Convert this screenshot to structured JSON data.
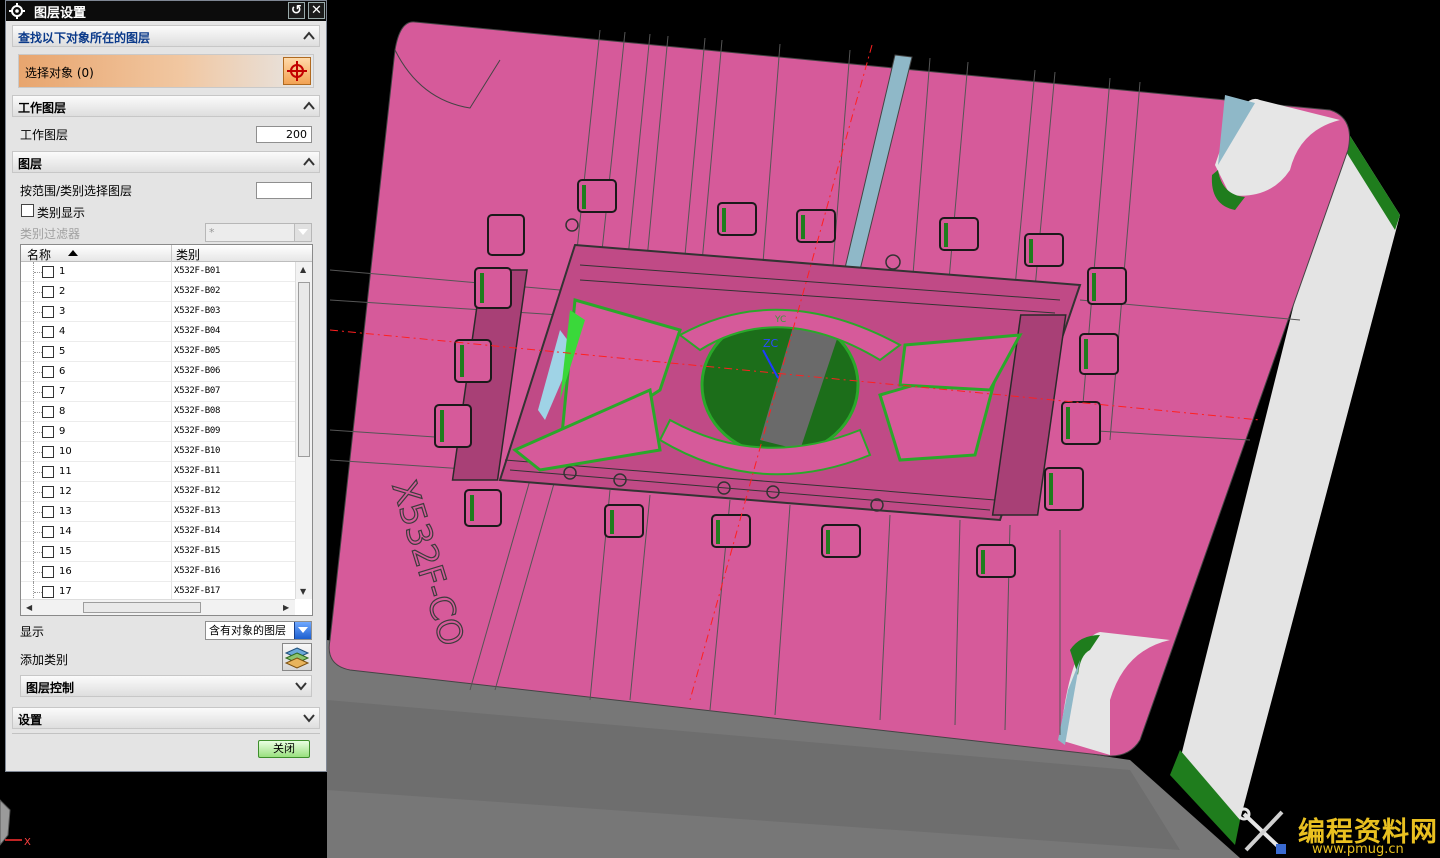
{
  "dialog": {
    "title": "图层设置",
    "find_section": {
      "label": "查找以下对象所在的图层",
      "select_object": "选择对象 (0)"
    },
    "work_layer_section": {
      "label": "工作图层",
      "work_layer_label": "工作图层",
      "work_layer_value": "200"
    },
    "layers_section": {
      "label": "图层",
      "range_select_label": "按范围/类别选择图层",
      "range_select_value": "",
      "category_display_label": "类别显示",
      "category_filter_label": "类别过滤器",
      "category_filter_value": "*",
      "columns": [
        "名称",
        "类别"
      ],
      "rows": [
        {
          "name": "1",
          "category": "X532F-B01"
        },
        {
          "name": "2",
          "category": "X532F-B02"
        },
        {
          "name": "3",
          "category": "X532F-B03"
        },
        {
          "name": "4",
          "category": "X532F-B04"
        },
        {
          "name": "5",
          "category": "X532F-B05"
        },
        {
          "name": "6",
          "category": "X532F-B06"
        },
        {
          "name": "7",
          "category": "X532F-B07"
        },
        {
          "name": "8",
          "category": "X532F-B08"
        },
        {
          "name": "9",
          "category": "X532F-B09"
        },
        {
          "name": "10",
          "category": "X532F-B10"
        },
        {
          "name": "11",
          "category": "X532F-B11"
        },
        {
          "name": "12",
          "category": "X532F-B12"
        },
        {
          "name": "13",
          "category": "X532F-B13"
        },
        {
          "name": "14",
          "category": "X532F-B14"
        },
        {
          "name": "15",
          "category": "X532F-B15"
        },
        {
          "name": "16",
          "category": "X532F-B16"
        },
        {
          "name": "17",
          "category": "X532F-B17"
        }
      ],
      "display_label": "显示",
      "display_value": "含有对象的图层",
      "add_category_label": "添加类别",
      "layer_control_label": "图层控制"
    },
    "settings_section": {
      "label": "设置"
    },
    "close_label": "关闭"
  },
  "viewport": {
    "part_text": "X532F-CO",
    "axis_zc": "ZC",
    "axis_yc": "YC",
    "triad_x": "X",
    "colors": {
      "face": "#d65a9a",
      "green": "#1e7a1c",
      "bright_green": "#33e830",
      "wall": "#8fb8c8",
      "side": "#e6e6e6",
      "bottom": "#7a7a7a"
    }
  },
  "watermark": {
    "text": "编程资料网",
    "url": "www.pmug.cn"
  }
}
